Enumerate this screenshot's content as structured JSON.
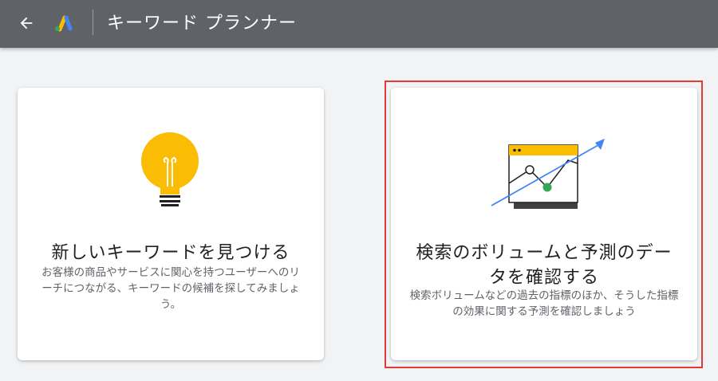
{
  "header": {
    "title": "キーワード プランナー",
    "background": "#5f6368"
  },
  "cards": [
    {
      "title": "新しいキーワードを見つける",
      "description": "お客様の商品やサービスに関心を持つユーザーへのリーチにつながる、キーワードの候補を探してみましょう。",
      "icon": "lightbulb-icon"
    },
    {
      "title": "検索のボリュームと予測のデータを確認する",
      "description": "検索ボリュームなどの過去の指標のほか、そうした指標の効果に関する予測を確認しましょう",
      "icon": "forecast-chart-icon"
    }
  ],
  "colors": {
    "accent_yellow": "#fbbc04",
    "accent_blue": "#4285f4",
    "accent_green": "#34a853",
    "highlight_border": "#e53935"
  }
}
